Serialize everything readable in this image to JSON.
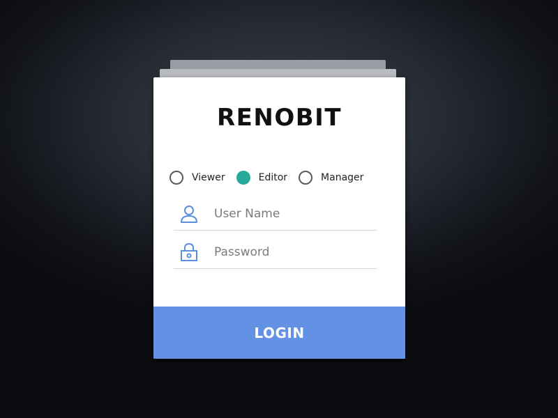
{
  "brand": {
    "logo_text": "RENOBIT"
  },
  "roles": [
    {
      "label": "Viewer",
      "checked": false
    },
    {
      "label": "Editor",
      "checked": true
    },
    {
      "label": "Manager",
      "checked": false
    }
  ],
  "form": {
    "username": {
      "placeholder": "User Name",
      "value": "",
      "icon": "user-icon"
    },
    "password": {
      "placeholder": "Password",
      "value": "",
      "icon": "lock-icon"
    }
  },
  "login_button": {
    "label": "LOGIN"
  },
  "colors": {
    "accent": "#6391e3",
    "radio_selected": "#26a99a",
    "icon_blue": "#5b8ee0"
  }
}
